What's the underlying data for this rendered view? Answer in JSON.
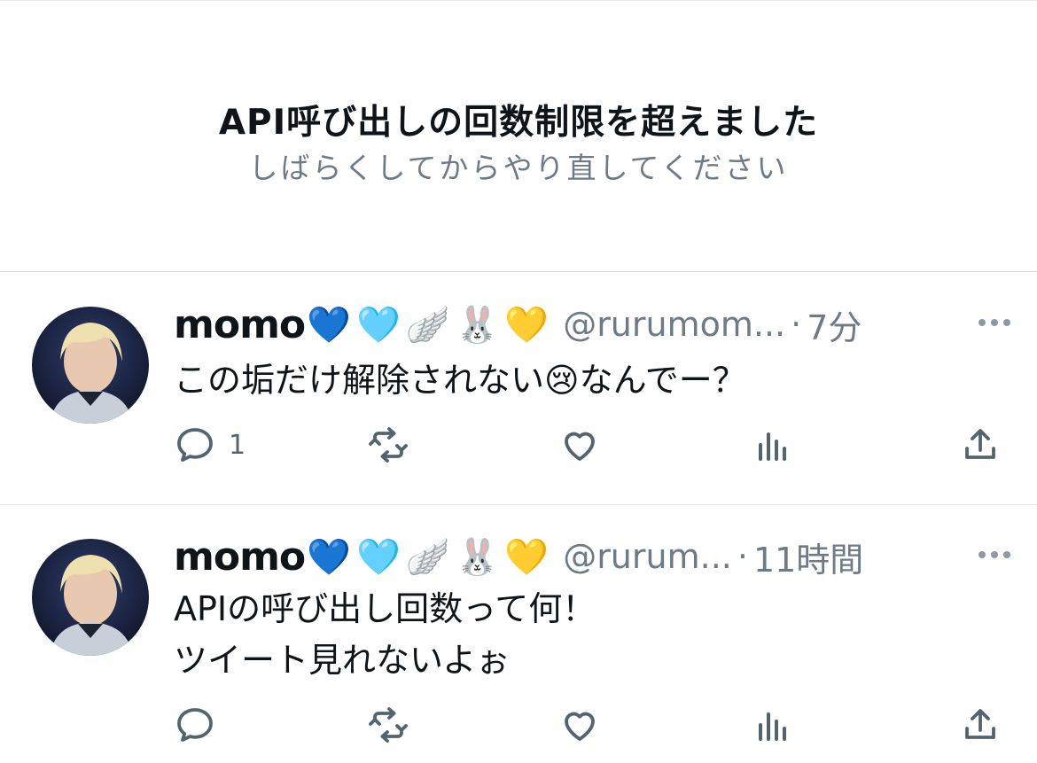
{
  "banner": {
    "title": "API呼び出しの回数制限を超えました",
    "subtitle": "しばらくしてからやり直してください"
  },
  "tweets": [
    {
      "name": "momo",
      "emojis": "💙🩵🪽🐰💛",
      "handle": "@rurumom...",
      "time": "7分",
      "text": "この垢だけ解除されない😢なんでー？",
      "reply_count": "1",
      "avatar_icon": "profile-photo"
    },
    {
      "name": "momo",
      "emojis": "💙🩵🪽🐰💛",
      "handle": "@rurum...",
      "time": "11時間",
      "text_line1": "APIの呼び出し回数って何！",
      "text_line2": "ツイート見れないよぉ",
      "reply_count": "",
      "avatar_icon": "profile-photo"
    }
  ],
  "separator": "·",
  "icons": [
    "reply-icon",
    "retweet-icon",
    "like-icon",
    "views-icon",
    "share-icon",
    "more-icon"
  ],
  "colors": {
    "text": "#0f1419",
    "secondary": "#536471",
    "divider": "#e1e4e8"
  }
}
